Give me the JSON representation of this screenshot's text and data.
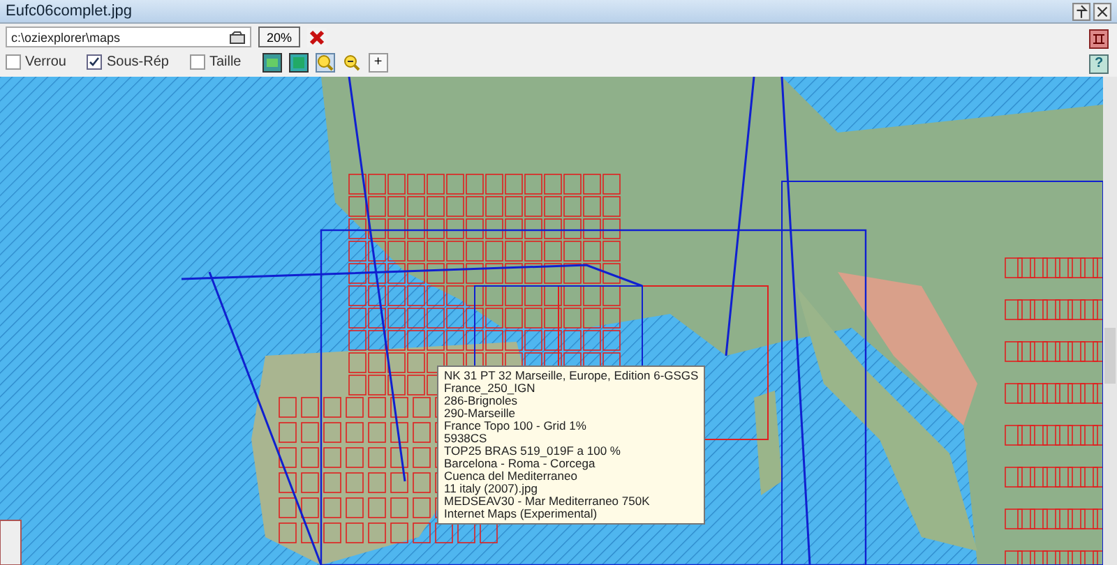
{
  "window": {
    "title": "Eufc06complet.jpg"
  },
  "toolbar": {
    "path": "c:\\oziexplorer\\maps",
    "zoom": "20%",
    "options": [
      {
        "label": "Verrou",
        "checked": false
      },
      {
        "label": "Sous-Rép",
        "checked": true
      },
      {
        "label": "Taille",
        "checked": false
      }
    ],
    "plus": "+"
  },
  "help": "?",
  "tooltip": {
    "lines": [
      "NK 31 PT 32 Marseille, Europe, Edition 6-GSGS",
      "France_250_IGN",
      "286-Brignoles",
      "290-Marseille",
      "France Topo 100 - Grid 1%",
      "5938CS",
      "TOP25 BRAS 519_019F a 100 %",
      "Barcelona - Roma - Corcega",
      "Cuenca del Mediterraneo",
      "11 italy (2007).jpg",
      "MEDSEAV30 - Mar Mediterraneo 750K",
      "Internet Maps (Experimental)"
    ]
  }
}
